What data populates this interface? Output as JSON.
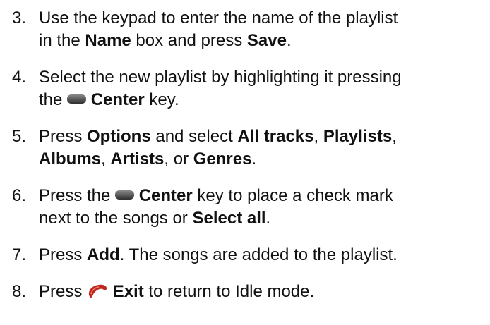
{
  "steps": [
    {
      "number": "3.",
      "line1_a": "Use the keypad to enter the name of the playlist",
      "line2_a": "in the ",
      "line2_b": "Name",
      "line2_c": " box and press ",
      "line2_d": "Save",
      "line2_e": "."
    },
    {
      "number": "4.",
      "line1_a": "Select the new playlist by highlighting it pressing",
      "line2_a": "the ",
      "line2_icon": "center-key-icon",
      "line2_b": "Center",
      "line2_c": " key."
    },
    {
      "number": "5.",
      "line1_a": "Press ",
      "line1_b": "Options",
      "line1_c": " and select ",
      "line1_d": "All tracks",
      "line1_e": ", ",
      "line1_f": "Playlists",
      "line1_g": ",",
      "line2_a": "Albums",
      "line2_b": ", ",
      "line2_c": "Artists",
      "line2_d": ", or ",
      "line2_e": "Genres",
      "line2_f": "."
    },
    {
      "number": "6.",
      "line1_a": "Press the ",
      "line1_icon": "center-key-icon",
      "line1_b": "Center",
      "line1_c": " key to place a check mark",
      "line2_a": "next to the songs or ",
      "line2_b": "Select all",
      "line2_c": "."
    },
    {
      "number": "7.",
      "line1_a": "Press ",
      "line1_b": "Add",
      "line1_c": ". The songs are added to the playlist."
    },
    {
      "number": "8.",
      "line1_a": "Press ",
      "line1_icon": "end-key-icon",
      "line1_b": "Exit",
      "line1_c": " to return to Idle mode."
    }
  ],
  "colors": {
    "text": "#111111",
    "key_icon": "#555555",
    "end_key_icon": "#c0281e"
  }
}
